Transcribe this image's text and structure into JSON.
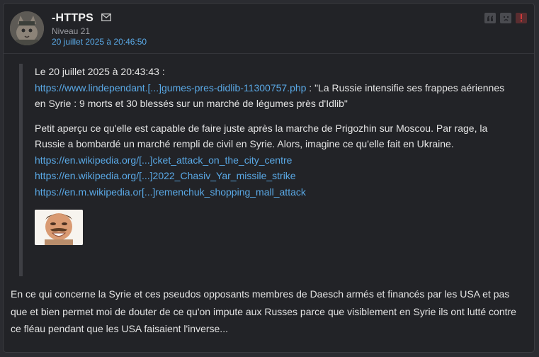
{
  "post": {
    "username": "-HTTPS",
    "level": "Niveau 21",
    "date": "20 juillet 2025 à 20:46:50",
    "actions": [
      "quote-icon",
      "sad-face-icon",
      "alert-icon"
    ]
  },
  "quote": {
    "header": "Le 20 juillet 2025 à 20:43:43 :",
    "link1": "https://www.lindependant.[...]gumes-pres-didlib-11300757.php",
    "link1_text": " : \"La Russie intensifie ses frappes aériennes en Syrie : 9 morts et 30 blessés sur un marché de légumes près d'Idlib\"",
    "paragraph": "Petit aperçu ce qu'elle est capable de faire juste après la marche de Prigozhin sur Moscou. Par rage, la Russie a bombardé un marché rempli de civil en Syrie. Alors, imagine ce qu'elle fait en Ukraine.",
    "links": [
      "https://en.wikipedia.org/[...]cket_attack_on_the_city_centre",
      "https://en.wikipedia.org/[...]2022_Chasiv_Yar_missile_strike",
      "https://en.m.wikipedia.or[...]remenchuk_shopping_mall_attack"
    ]
  },
  "body": "En ce qui concerne la Syrie et ces pseudos opposants membres de Daesch armés et financés par les USA et pas que et bien permet moi de douter de ce qu'on impute aux Russes parce que visiblement en Syrie ils ont lutté contre ce fléau pendant que les USA faisaient l'inverse..."
}
